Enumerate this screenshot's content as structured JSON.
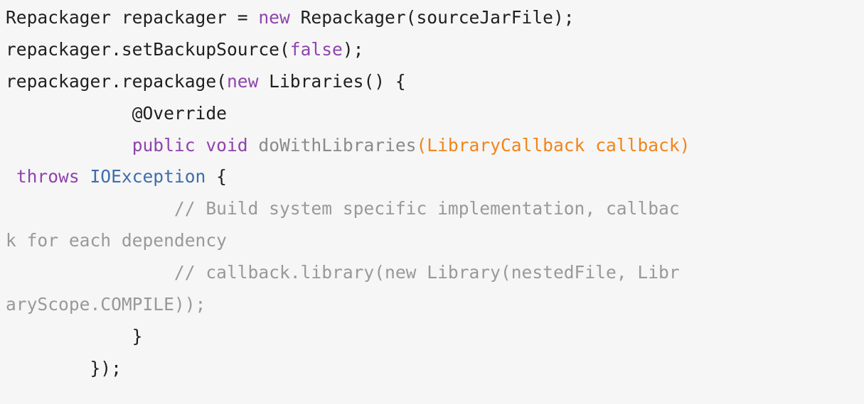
{
  "code": {
    "lines": [
      [
        {
          "t": "Repackager repackager = ",
          "k": "plain"
        },
        {
          "t": "new",
          "k": "keyword"
        },
        {
          "t": " Repackager(sourceJarFile);",
          "k": "plain"
        }
      ],
      [
        {
          "t": "repackager.setBackupSource(",
          "k": "plain"
        },
        {
          "t": "false",
          "k": "literal"
        },
        {
          "t": ");",
          "k": "plain"
        }
      ],
      [
        {
          "t": "repackager.repackage(",
          "k": "plain"
        },
        {
          "t": "new",
          "k": "keyword"
        },
        {
          "t": " Libraries() {",
          "k": "plain"
        }
      ],
      [
        {
          "t": "            @Override",
          "k": "annotation"
        }
      ],
      [
        {
          "t": "            ",
          "k": "plain"
        },
        {
          "t": "public",
          "k": "keyword"
        },
        {
          "t": " ",
          "k": "plain"
        },
        {
          "t": "void",
          "k": "keyword"
        },
        {
          "t": " ",
          "k": "plain"
        },
        {
          "t": "doWithLibraries",
          "k": "method-name"
        },
        {
          "t": "(LibraryCallback callback)",
          "k": "params"
        }
      ],
      [
        {
          "t": " ",
          "k": "plain"
        },
        {
          "t": "throws",
          "k": "keyword"
        },
        {
          "t": " ",
          "k": "plain"
        },
        {
          "t": "IOException",
          "k": "type"
        },
        {
          "t": " {",
          "k": "plain"
        }
      ],
      [
        {
          "t": "                // Build system specific implementation, callbac",
          "k": "comment"
        }
      ],
      [
        {
          "t": "k for each dependency",
          "k": "comment"
        }
      ],
      [
        {
          "t": "                // callback.library(new Library(nestedFile, Libr",
          "k": "comment"
        }
      ],
      [
        {
          "t": "aryScope.COMPILE));",
          "k": "comment"
        }
      ],
      [
        {
          "t": "            }",
          "k": "plain"
        }
      ],
      [
        {
          "t": "        });",
          "k": "plain"
        }
      ]
    ]
  }
}
